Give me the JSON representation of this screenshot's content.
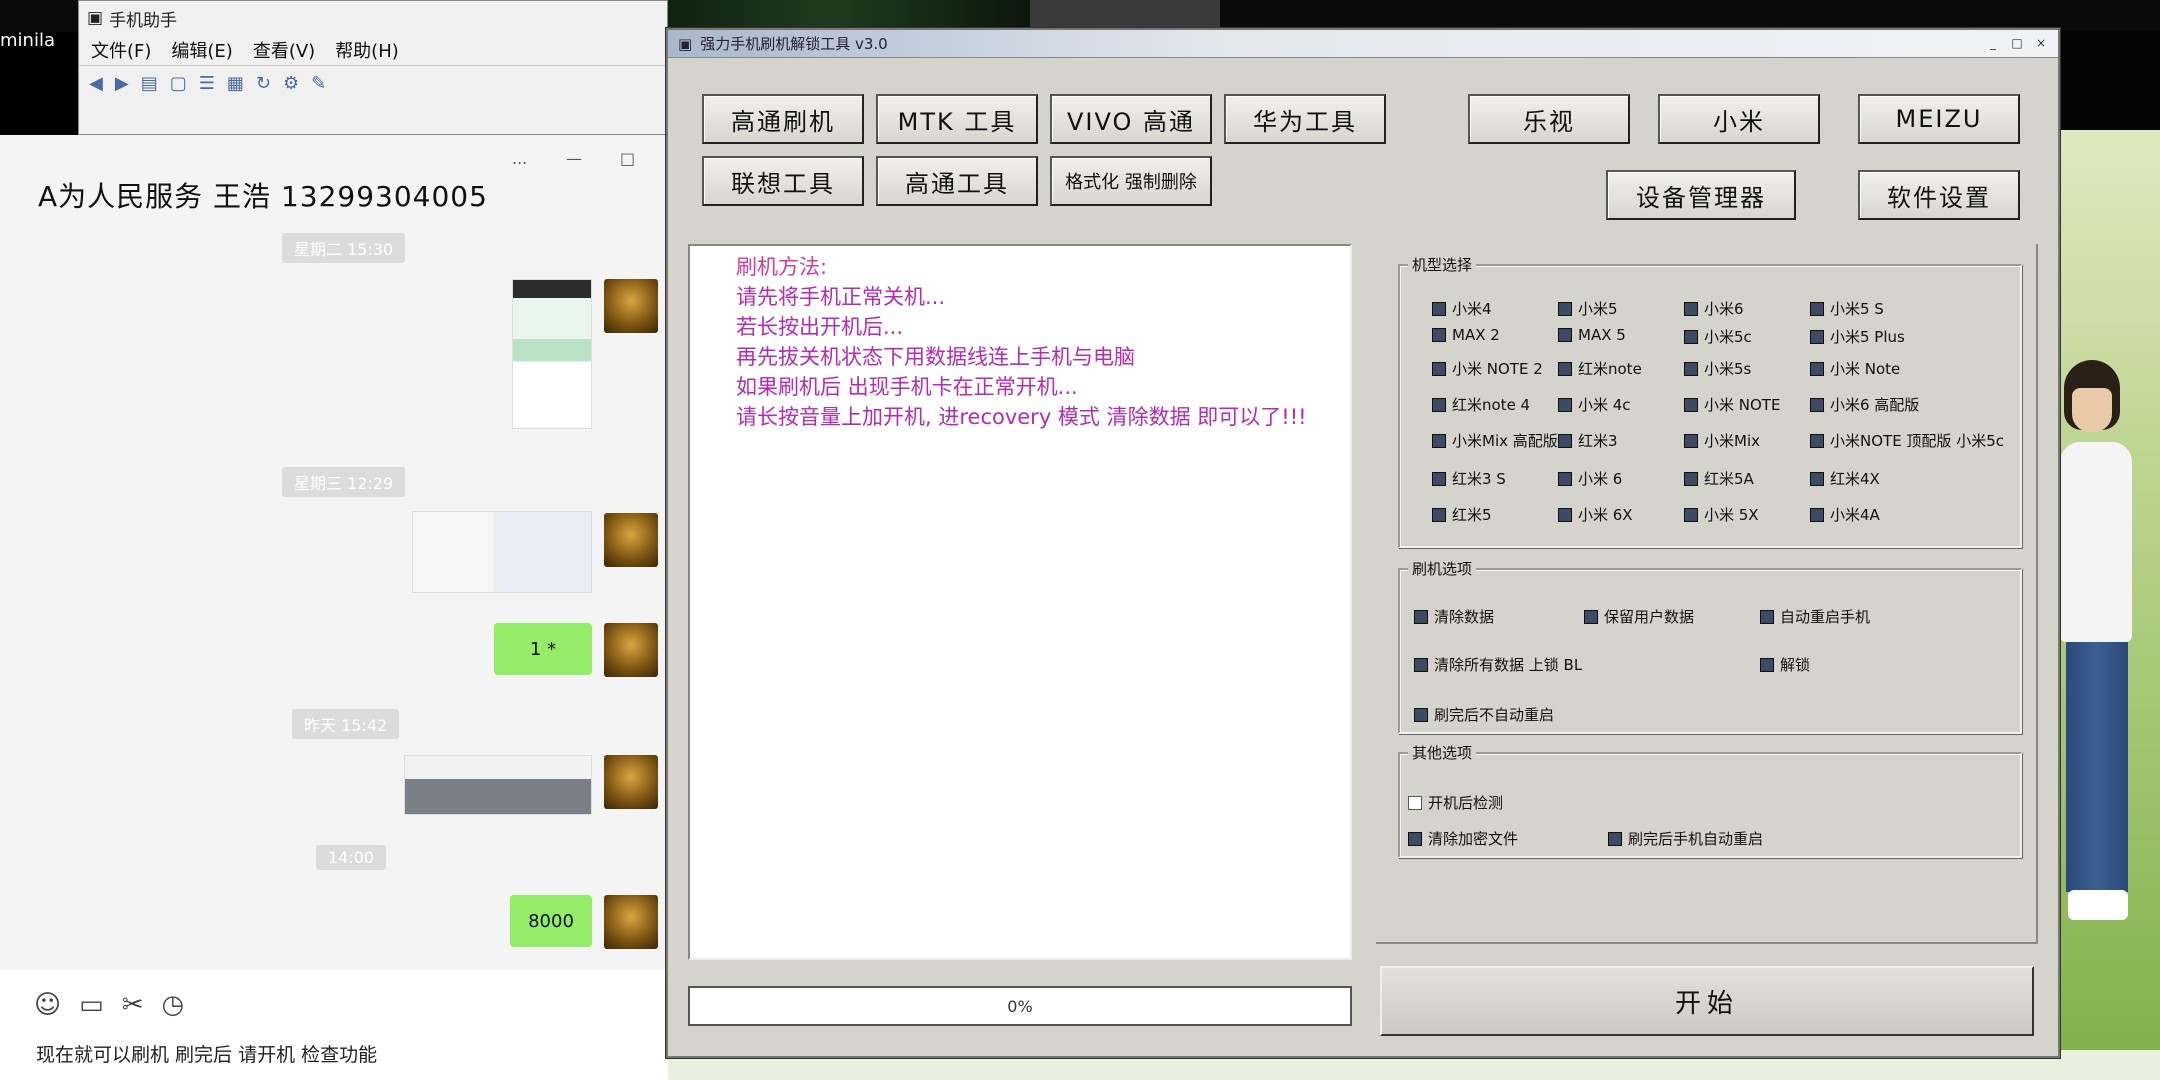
{
  "desktop": {
    "left_icon_label": "minila"
  },
  "back_window": {
    "title": "手机助手",
    "menu": [
      "文件(F)",
      "编辑(E)",
      "查看(V)",
      "帮助(H)"
    ],
    "toolbar_icons": [
      "back-icon",
      "forward-icon",
      "view-icon",
      "doc-icon",
      "list-icon",
      "grid-icon",
      "refresh-icon",
      "settings-icon",
      "tools-icon"
    ]
  },
  "chat": {
    "contact_name": "A为人民服务 王浩 13299304005",
    "controls": [
      "...",
      "—",
      "□"
    ],
    "times": [
      "星期二 15:30",
      "星期三 12:29",
      "昨天 15:42",
      "14:00"
    ],
    "messages": [
      {
        "type": "image"
      },
      {
        "type": "image"
      },
      {
        "type": "text",
        "text": "1 *"
      },
      {
        "type": "image"
      },
      {
        "type": "text",
        "text": "8000"
      }
    ],
    "tool_icons": [
      "emoji-icon",
      "folder-icon",
      "scissors-icon",
      "chat-history-icon"
    ],
    "tip": "现在就可以刷机 刷完后 请开机 检查功能"
  },
  "tool": {
    "title": "强力手机刷机解锁工具 v3.0",
    "title_buttons": [
      "_",
      "□",
      "×"
    ],
    "row1": [
      "高通刷机",
      "MTK 工具",
      "VIVO 高通",
      "华为工具",
      "乐视",
      "小米",
      "MEIZU"
    ],
    "row2": [
      "联想工具",
      "高通工具",
      "格式化 强制删除"
    ],
    "row2_right": [
      "设备管理器",
      "软件设置"
    ],
    "log": [
      "刷机方法:",
      "请先将手机正常关机...",
      "若长按出开机后...",
      "再先拔关机状态下用数据线连上手机与电脑",
      "如果刷机后 出现手机卡在正常开机...",
      "请长按音量上加开机, 进recovery 模式 清除数据 即可以了!!!"
    ],
    "progress_label": "0%",
    "group1": {
      "legend": "机型选择",
      "items": [
        "小米4",
        "小米5",
        "小米6",
        "小米5 S",
        "MAX 2",
        "MAX 5",
        "小米5c",
        "小米5 Plus",
        "小米 NOTE 2",
        "红米note",
        "小米5s",
        "小米 Note",
        "红米note 4",
        "小米 4c",
        "小米 NOTE",
        "小米6 高配版",
        "小米Mix 高配版",
        "红米3",
        "小米Mix",
        "小米NOTE 顶配版 小米5c",
        "红米3 S",
        "小米 6",
        "红米5A",
        "红米4X",
        "红米5",
        "小米 6X",
        "小米 5X",
        "小米4A"
      ]
    },
    "group2": {
      "legend": "刷机选项",
      "items": [
        "清除数据",
        "保留用户数据",
        "自动重启手机",
        "清除所有数据 上锁 BL",
        "解锁",
        "刷完后不自动重启"
      ]
    },
    "group3": {
      "legend": "其他选项",
      "items": [
        "开机后检测",
        "清除加密文件",
        "刷完后手机自动重启"
      ]
    },
    "start_label": "开始"
  },
  "colors": {
    "log_text": "#b32cb3",
    "chat_bubble": "#95ec69",
    "window_bg": "#d4d3cc"
  }
}
